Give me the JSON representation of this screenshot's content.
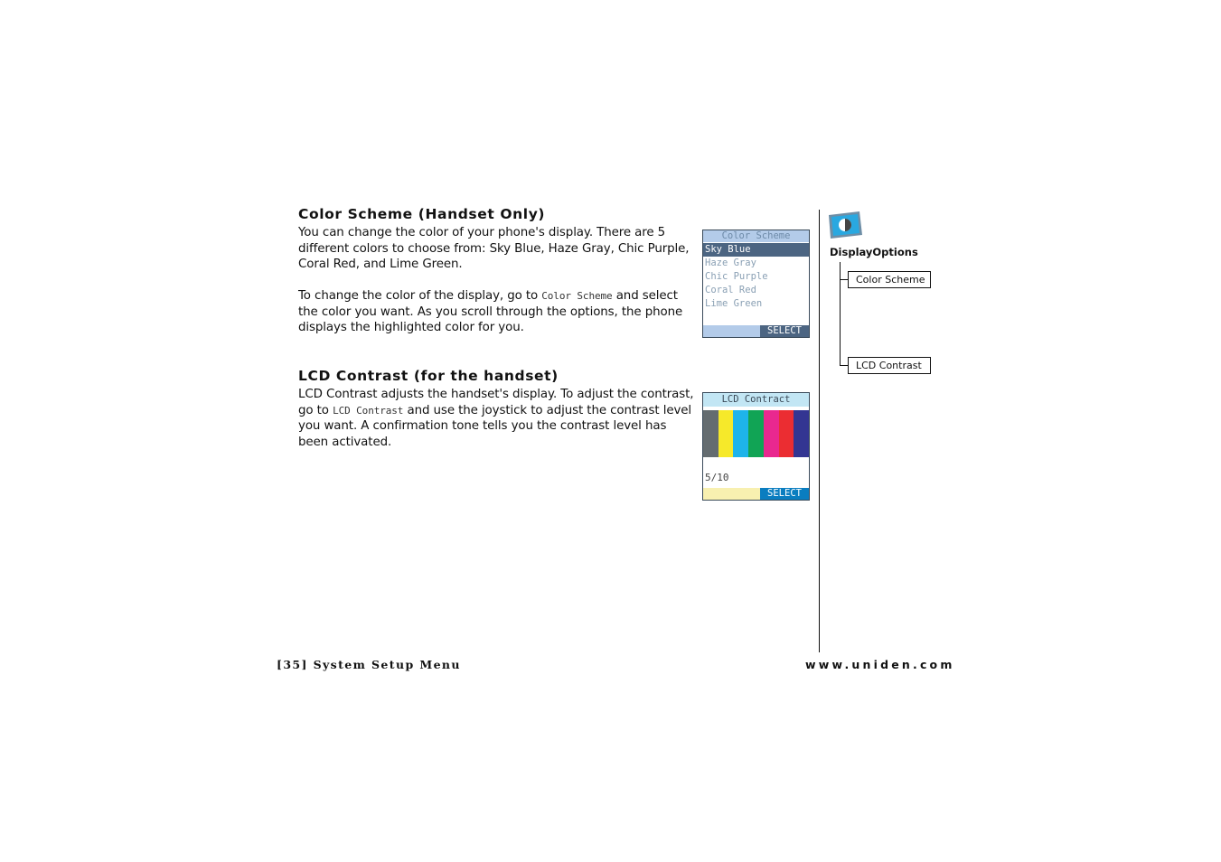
{
  "sections": [
    {
      "heading": "Color Scheme (Handset Only)",
      "para1": "You can change the color of your phone's display. There are 5 different colors to choose from: Sky Blue, Haze Gray, Chic Purple, Coral Red, and Lime Green.",
      "para2_before": "To change the color of the display, go to ",
      "para2_menu": "Color Scheme",
      "para2_after": " and select the color you want. As you scroll through the options, the phone displays the highlighted color for you."
    },
    {
      "heading": "LCD Contrast (for the handset)",
      "para_before": "LCD Contrast adjusts the handset's display. To adjust the contrast, go to ",
      "para_menu": "LCD Contrast",
      "para_after": " and use the joystick to adjust the contrast level you want. A confirmation tone tells you the contrast level has been activated."
    }
  ],
  "color_scheme_screen": {
    "title": "Color Scheme",
    "options": [
      "Sky Blue",
      "Haze Gray",
      "Chic Purple",
      "Coral Red",
      "Lime Green"
    ],
    "selected_index": 0,
    "softkey": "SELECT",
    "colors": {
      "title_bg": "#b3cbe9",
      "selected_bg": "#4c6582",
      "softkey_bg": "#4c6582",
      "bar_bg": "#b3cbe9"
    }
  },
  "lcd_contrast_screen": {
    "title": "LCD Contract",
    "color_bars": [
      "#646c70",
      "#f6e92a",
      "#1eb4ea",
      "#11a455",
      "#e9288f",
      "#eb2d32",
      "#333592"
    ],
    "sub_bars": [
      "#4b2a85",
      "#ffffff",
      "#2c3190",
      "#231f20",
      "#231f20",
      "#231f20",
      "#231f20"
    ],
    "level": "5/10",
    "softkey": "SELECT",
    "colors": {
      "title_bg": "#c2e6f4",
      "softkey_bg": "#0a7dc0",
      "bar_bg": "#f8f0b0"
    }
  },
  "sidebar": {
    "icon": "display-options-icon",
    "title": "DisplayOptions",
    "items": [
      "Color Scheme",
      "LCD Contrast"
    ]
  },
  "footer": {
    "left": "[35] System Setup Menu",
    "right": "www.uniden.com"
  }
}
